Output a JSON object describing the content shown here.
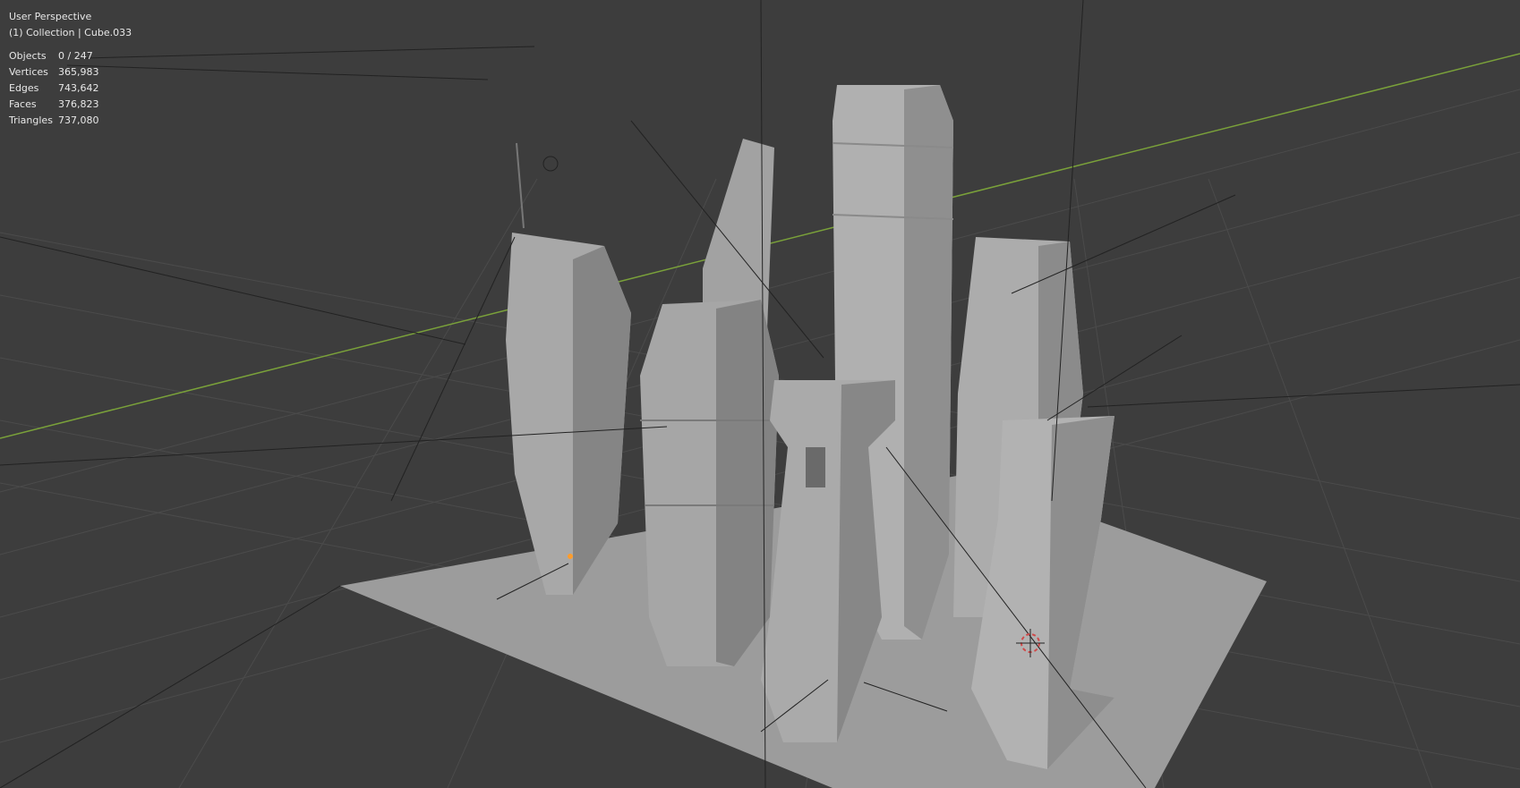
{
  "viewport": {
    "view_mode": "User Perspective",
    "context": "(1) Collection | Cube.033",
    "stats": [
      {
        "label": "Objects",
        "value": "0 / 247"
      },
      {
        "label": "Vertices",
        "value": "365,983"
      },
      {
        "label": "Edges",
        "value": "743,642"
      },
      {
        "label": "Faces",
        "value": "376,823"
      },
      {
        "label": "Triangles",
        "value": "737,080"
      }
    ]
  },
  "colors": {
    "background": "#3d3d3d",
    "grid": "#4a4a4a",
    "x_axis": "#7aa13a",
    "model": "#a6a6a6",
    "model_shadow": "#7e7e7e",
    "overlay_text": "#e8e8e8"
  }
}
